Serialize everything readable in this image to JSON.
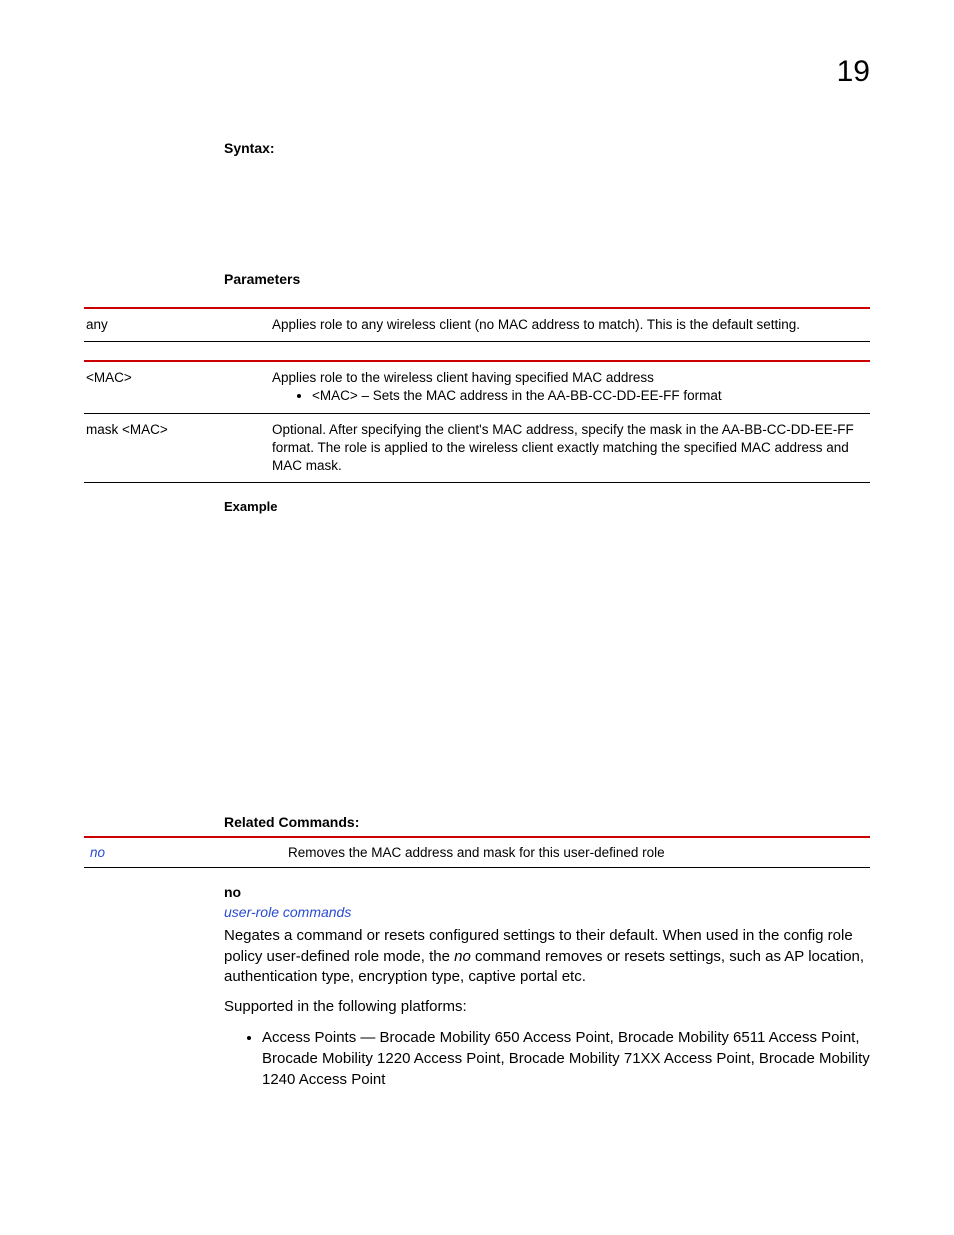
{
  "chapter_number": "19",
  "sections": {
    "syntax_label": "Syntax:",
    "parameters_label": "Parameters",
    "example_label": "Example",
    "related_label": "Related Commands:"
  },
  "param_table1": {
    "rows": [
      {
        "c1": "any",
        "c2": "Applies role to any wireless client (no MAC address to match). This is the default setting."
      }
    ]
  },
  "param_table2": {
    "rows": [
      {
        "c1": "<MAC>",
        "c2a": "Applies role to the wireless client having specified MAC address",
        "c2b": "<MAC> – Sets the MAC address in the AA-BB-CC-DD-EE-FF format"
      },
      {
        "c1": "mask <MAC>",
        "c2": "Optional. After specifying the client's MAC address, specify the mask in the AA-BB-CC-DD-EE-FF format. The role is applied to the wireless client exactly matching the specified MAC address and MAC mask."
      }
    ]
  },
  "related_table": {
    "rows": [
      {
        "c1": "no",
        "c2": "Removes the MAC address and mask for this user-defined role"
      }
    ]
  },
  "no_section": {
    "heading": "no",
    "link": "user-role commands",
    "body_pre": "Negates a command or resets configured settings to their default. When used in the config role policy user-defined role mode, the ",
    "body_em": "no",
    "body_post": " command removes or resets settings, such as AP location, authentication type, encryption type, captive portal etc.",
    "supported_label": "Supported in the following platforms:",
    "platform_bullet": "Access Points — Brocade Mobility 650 Access Point, Brocade Mobility 6511 Access Point, Brocade Mobility 1220 Access Point, Brocade Mobility 71XX Access Point, Brocade Mobility 1240 Access Point"
  }
}
